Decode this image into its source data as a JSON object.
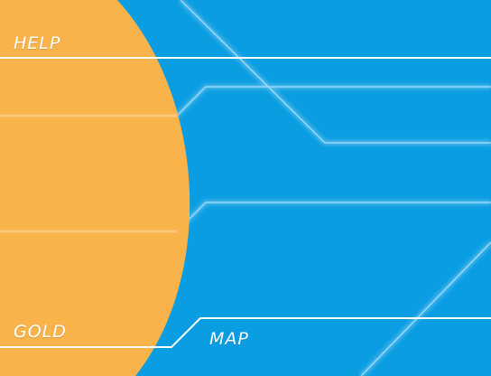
{
  "menu": {
    "help_label": "HELP",
    "gold_label": "GOLD",
    "map_label": "MAP"
  },
  "colors": {
    "background": "#0a9de2",
    "planet": "#f8b34b",
    "line": "#ffffff"
  }
}
